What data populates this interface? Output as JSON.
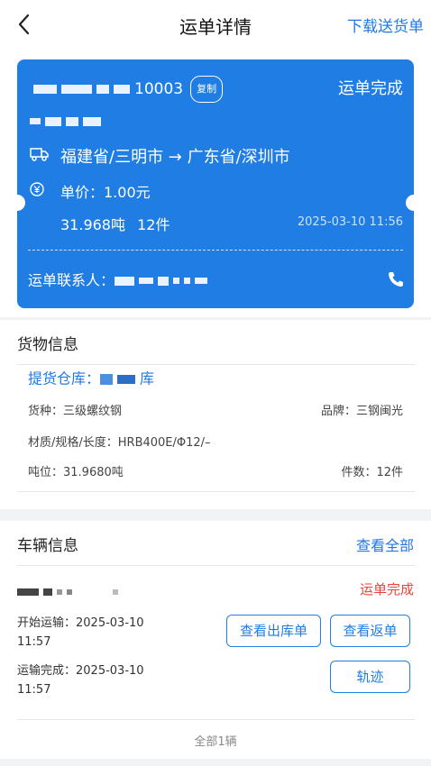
{
  "header": {
    "title": "运单详情",
    "right_link": "下载送货单"
  },
  "waybill": {
    "number_suffix": "10003",
    "copy_label": "复制",
    "status": "运单完成",
    "route": "福建省/三明市 → 广东省/深圳市",
    "unit_price": "单价：1.00元",
    "weight": "31.968吨",
    "pieces": "12件",
    "datetime": "2025-03-10 11:56",
    "contact_label": "运单联系人："
  },
  "cargo": {
    "section_title": "货物信息",
    "warehouse_label": "提货仓库：",
    "warehouse_suffix": "库",
    "type": "货种：三级螺纹钢",
    "brand": "品牌：三钢闽光",
    "spec": "材质/规格/长度：HRB400E/Φ12/–",
    "tonnage": "吨位：31.9680吨",
    "count": "件数：12件"
  },
  "vehicles": {
    "section_title": "车辆信息",
    "view_all": "查看全部",
    "status": "运单完成",
    "start_label": "开始运输：2025-03-10",
    "start_time": "11:57",
    "end_label": "运输完成：2025-03-10",
    "end_time": "11:57",
    "btn_outbound": "查看出库单",
    "btn_return": "查看返单",
    "btn_track": "轨迹",
    "footer": "全部1辆"
  },
  "colors": {
    "accent": "#1f7de3",
    "status_red": "#e8453c"
  }
}
